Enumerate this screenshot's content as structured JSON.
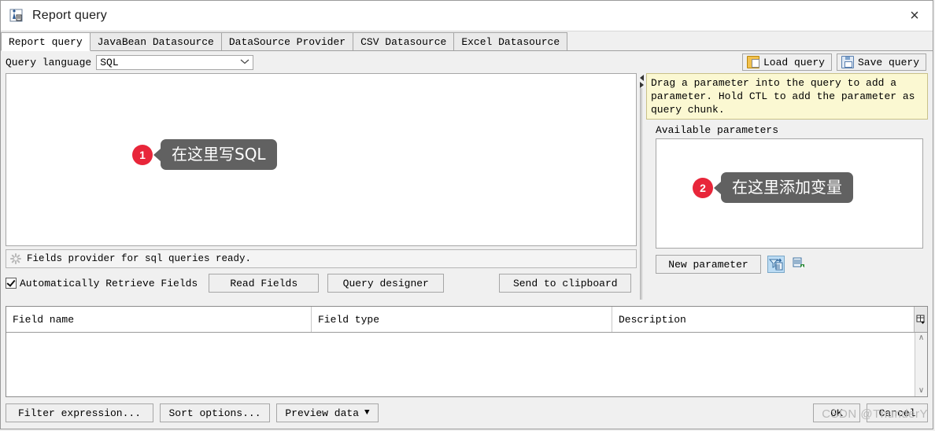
{
  "window": {
    "title": "Report query",
    "icon": "report-query-icon",
    "close_label": "×"
  },
  "tabs": [
    {
      "label": "Report query",
      "active": true
    },
    {
      "label": "JavaBean Datasource",
      "active": false
    },
    {
      "label": "DataSource Provider",
      "active": false
    },
    {
      "label": "CSV Datasource",
      "active": false
    },
    {
      "label": "Excel Datasource",
      "active": false
    }
  ],
  "query_language": {
    "label": "Query language",
    "value": "SQL",
    "options": [
      "SQL"
    ],
    "arrow": "⌄"
  },
  "toolbar": {
    "load_query": "Load query",
    "save_query": "Save query"
  },
  "sql_editor": {
    "value": "",
    "placeholder": ""
  },
  "status": {
    "text": "Fields provider for sql queries ready."
  },
  "left_controls": {
    "auto_retrieve_label": "Automatically Retrieve Fields",
    "auto_retrieve_checked": true,
    "read_fields": "Read Fields",
    "query_designer": "Query designer",
    "send_to_clipboard": "Send to clipboard"
  },
  "right_panel": {
    "hint": "Drag a parameter into the query to add a parameter. Hold CTL to add the parameter as query chunk.",
    "available_parameters_label": "Available parameters",
    "parameter_list": [],
    "new_parameter": "New parameter",
    "icon_filter": "filter-parameter-icon",
    "icon_import": "import-parameter-icon"
  },
  "fields_table": {
    "columns": [
      "Field name",
      "Field type",
      "Description"
    ],
    "rows": [],
    "config_icon": "table-config-icon",
    "scroll_up": "∧",
    "scroll_down": "∨"
  },
  "bottom_bar": {
    "filter_expression": "Filter expression...",
    "sort_options": "Sort options...",
    "preview_data": "Preview data",
    "preview_arrow": "▼",
    "ok": "OK",
    "cancel": "Cancel"
  },
  "watermark": "CSDN @ThunderY",
  "callouts": [
    {
      "number": "1",
      "text": "在这里写SQL"
    },
    {
      "number": "2",
      "text": "在这里添加变量"
    }
  ],
  "colors": {
    "accent_red": "#e8263a",
    "bubble_gray": "#616161",
    "hint_yellow": "#fbf8d2"
  }
}
